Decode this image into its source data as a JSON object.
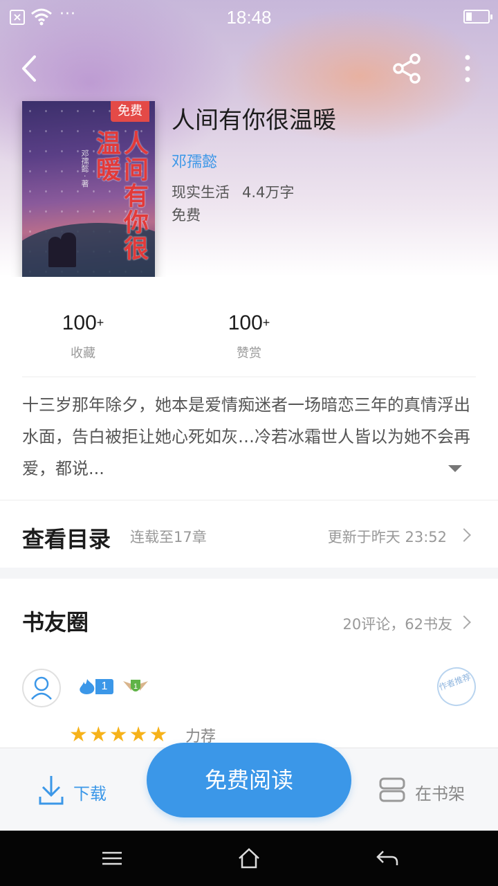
{
  "status_bar": {
    "time": "18:48",
    "dots": "···"
  },
  "book": {
    "badge": "免费",
    "title": "人间有你很温暖",
    "author": "邓孺懿",
    "genre": "现实生活",
    "word_count": "4.4万字",
    "price": "免费",
    "cover_title": "人间有你很温暖",
    "cover_author": "邓孺懿 · 著"
  },
  "stats": [
    {
      "value": "100",
      "suffix": "+",
      "label": "收藏"
    },
    {
      "value": "100",
      "suffix": "+",
      "label": "赞赏"
    }
  ],
  "summary": "十三岁那年除夕，她本是爱情痴迷者一场暗恋三年的真情浮出水面，告白被拒让她心死如灰…冷若冰霜世人皆以为她不会再爱，都说...",
  "toc": {
    "title": "查看目录",
    "subtitle": "连载至17章",
    "update": "更新于昨天 23:52"
  },
  "circle": {
    "title": "书友圈",
    "meta": "20评论，62书友",
    "comment": {
      "level": "1",
      "rank": "1",
      "stamp": "作者推荐",
      "stars": "★★★★★",
      "rating_text": "力荐"
    }
  },
  "bottom_bar": {
    "download": "下载",
    "read": "免费阅读",
    "shelf": "在书架"
  },
  "colors": {
    "accent": "#3b97e8",
    "badge_red": "#e44a47",
    "star": "#f6b21a"
  }
}
